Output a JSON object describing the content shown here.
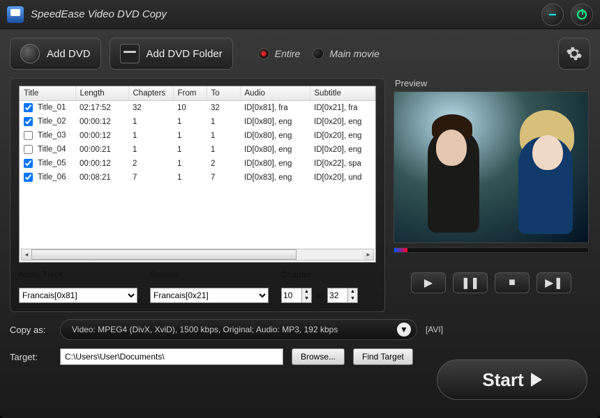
{
  "app": {
    "title": "SpeedEase Video DVD Copy"
  },
  "toolbar": {
    "add_dvd": "Add DVD",
    "add_folder": "Add DVD Folder",
    "mode_entire": "Entire",
    "mode_main": "Main movie"
  },
  "table": {
    "columns": [
      "Title",
      "Length",
      "Chapters",
      "From",
      "To",
      "Audio",
      "Subtitle"
    ],
    "rows": [
      {
        "checked": true,
        "title": "Title_01",
        "length": "02:17:52",
        "chapters": "32",
        "from": "10",
        "to": "32",
        "audio": "ID[0x81], fra",
        "subtitle": "ID[0x21], fra"
      },
      {
        "checked": true,
        "title": "Title_02",
        "length": "00:00:12",
        "chapters": "1",
        "from": "1",
        "to": "1",
        "audio": "ID[0x80], eng",
        "subtitle": "ID[0x20], eng"
      },
      {
        "checked": false,
        "title": "Title_03",
        "length": "00:00:12",
        "chapters": "1",
        "from": "1",
        "to": "1",
        "audio": "ID[0x80], eng",
        "subtitle": "ID[0x20], eng"
      },
      {
        "checked": false,
        "title": "Title_04",
        "length": "00:00:21",
        "chapters": "1",
        "from": "1",
        "to": "1",
        "audio": "ID[0x80], eng",
        "subtitle": "ID[0x20], eng"
      },
      {
        "checked": true,
        "title": "Title_05",
        "length": "00:00:12",
        "chapters": "2",
        "from": "1",
        "to": "2",
        "audio": "ID[0x80], eng",
        "subtitle": "ID[0x22], spa"
      },
      {
        "checked": true,
        "title": "Title_06",
        "length": "00:08:21",
        "chapters": "7",
        "from": "1",
        "to": "7",
        "audio": "ID[0x83], eng",
        "subtitle": "ID[0x20], und"
      }
    ]
  },
  "params": {
    "audio_label": "Audio Track:",
    "audio_value": "Francais[0x81]",
    "subtitle_label": "Subtitle:",
    "subtitle_value": "Francais[0x21]",
    "chapter_label": "Chapter:",
    "chapter_from": "10",
    "chapter_to_label": "to",
    "chapter_to": "32"
  },
  "preview": {
    "label": "Preview"
  },
  "copy": {
    "label": "Copy as:",
    "summary": "Video: MPEG4 (DivX, XviD), 1500 kbps, Original; Audio: MP3, 192 kbps",
    "format_tag": "[AVI]"
  },
  "target": {
    "label": "Target:",
    "path": "C:\\Users\\User\\Documents\\",
    "browse": "Browse...",
    "find": "Find Target"
  },
  "start": {
    "label": "Start"
  }
}
